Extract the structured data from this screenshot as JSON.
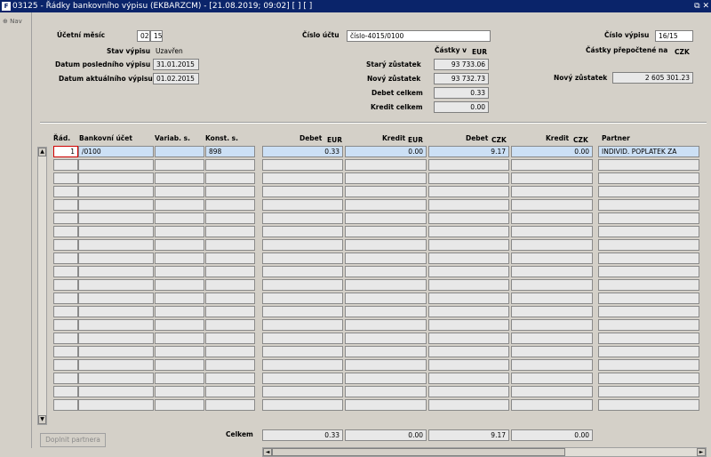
{
  "window": {
    "title": "03125 - Řádky bankovního výpisu (EKBARZCM) - [21.08.2019; 09:02]  [ ]  [ ]",
    "app_icon": "F",
    "controls": "⧉ ✕"
  },
  "nav": {
    "label": "Nav"
  },
  "header": {
    "ucetni_mesic_label": "Účetní měsíc",
    "ucetni_mesic_month": "02",
    "ucetni_mesic_year": "15",
    "cislo_uctu_label": "Číslo účtu",
    "cislo_uctu_value": "číslo-4015/0100",
    "cislo_vypisu_label": "Číslo výpisu",
    "cislo_vypisu_value": "16/15",
    "stav_vypisu_label": "Stav výpisu",
    "stav_vypisu_value": "Uzavřen",
    "castky_v_label": "Částky v",
    "castky_v_value": "EUR",
    "castky_prepoctene_label": "Částky přepočtené na",
    "castky_prepoctene_value": "CZK",
    "datum_posledniho_label": "Datum posledního výpisu",
    "datum_posledniho_value": "31.01.2015",
    "stary_zustatek_label": "Starý zůstatek",
    "stary_zustatek_value": "93 733.06",
    "datum_aktualniho_label": "Datum aktuálního výpisu",
    "datum_aktualniho_value": "01.02.2015",
    "novy_zustatek_label": "Nový zůstatek",
    "novy_zustatek_value": "93 732.73",
    "novy_zustatek_czk_label": "Nový zůstatek",
    "novy_zustatek_czk_value": "2 605 301.23",
    "debet_celkem_label": "Debet celkem",
    "debet_celkem_value": "0.33",
    "kredit_celkem_label": "Kredit celkem",
    "kredit_celkem_value": "0.00"
  },
  "grid": {
    "columns": {
      "rad": "Řád.",
      "bankovni_ucet": "Bankovní účet",
      "variab": "Variab. s.",
      "konst": "Konst. s.",
      "debet_eur": "Debet",
      "debet_eur_cur": "EUR",
      "kredit_eur": "Kredit",
      "kredit_eur_cur": "EUR",
      "debet_czk": "Debet",
      "debet_czk_cur": "CZK",
      "kredit_czk": "Kredit",
      "kredit_czk_cur": "CZK",
      "partner": "Partner"
    },
    "first_row": {
      "rad": "1",
      "bankovni_ucet": "/0100",
      "variab": "",
      "konst": "898",
      "debet_eur": "0.33",
      "kredit_eur": "0.00",
      "debet_czk": "9.17",
      "kredit_czk": "0.00",
      "partner": "INDIVID. POPLATEK ZA"
    },
    "totals": {
      "label": "Celkem",
      "debet_eur": "0.33",
      "kredit_eur": "0.00",
      "debet_czk": "9.17",
      "kredit_czk": "0.00"
    }
  },
  "buttons": {
    "doplnit_partnera": "Doplnit partnera"
  }
}
